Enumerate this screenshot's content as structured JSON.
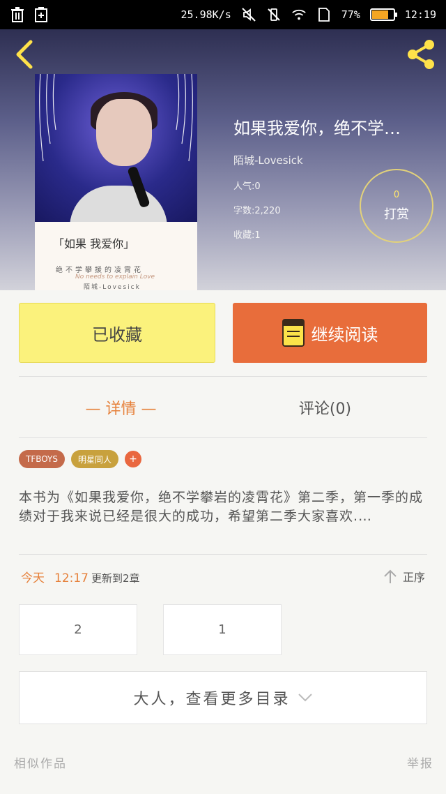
{
  "status_bar": {
    "speed": "25.98K/s",
    "battery_percent": "77%",
    "battery_level": 0.77,
    "time": "12:19",
    "icons": [
      "trash-icon",
      "clipboard-icon",
      "mute-icon",
      "vibrate-icon",
      "wifi-icon",
      "sim-icon",
      "battery-icon"
    ]
  },
  "header": {
    "back_icon": "back-chevron-icon",
    "share_icon": "share-icon"
  },
  "cover": {
    "title_text": "「如果 我爱你」",
    "tagline": "绝不学攀援的凌霄花",
    "english": "No needs to explain Love",
    "author_line": "陌城-Lovesick"
  },
  "book": {
    "title": "如果我爱你，绝不学…",
    "author": "陌城-Lovesick",
    "popularity": "人气:0",
    "word_count": "字数:2,220",
    "favorites": "收藏:1"
  },
  "tip": {
    "count": "0",
    "label": "打赏"
  },
  "actions": {
    "favorited_label": "已收藏",
    "continue_label": "继续阅读"
  },
  "tabs": {
    "detail": "— 详情 —",
    "comments": "评论(0)"
  },
  "tags": [
    "TFBOYS",
    "明星同人"
  ],
  "tag_add": "+",
  "description": "本书为《如果我爱你，绝不学攀岩的凌霄花》第二季，第一季的成绩对于我来说已经是很大的成功，希望第二季大家喜欢.…",
  "update": {
    "today": "今天",
    "time": "12:17",
    "text": "更新到2章"
  },
  "sort": {
    "label": "正序"
  },
  "chapters": [
    "2",
    "1"
  ],
  "more_label": "大人，查看更多目录",
  "footer": {
    "similar": "相似作品",
    "report": "举报"
  },
  "colors": {
    "accent_orange": "#e86d3b",
    "fav_yellow": "#fbf27c",
    "text_orange": "#e6813b"
  }
}
